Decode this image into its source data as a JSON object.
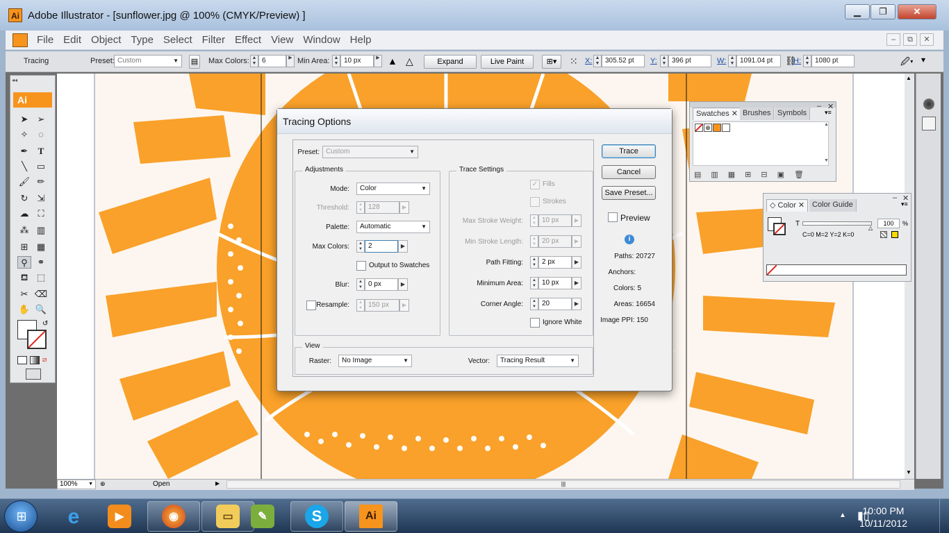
{
  "window": {
    "title": "Adobe Illustrator - [sunflower.jpg @ 100% (CMYK/Preview) ]",
    "app_icon": "Ai",
    "min_icon": "minimize-icon",
    "max_icon": "maximize-icon",
    "close_icon": "close-icon"
  },
  "menubar": {
    "items": [
      "File",
      "Edit",
      "Object",
      "Type",
      "Select",
      "Filter",
      "Effect",
      "View",
      "Window",
      "Help"
    ],
    "doc_controls": [
      "–",
      "⧉",
      "✕"
    ]
  },
  "controlbar": {
    "mode_label": "Tracing",
    "preset_label": "Preset:",
    "preset_value": "Custom",
    "max_colors_label": "Max Colors:",
    "max_colors_value": "6",
    "min_area_label": "Min Area:",
    "min_area_value": "10 px",
    "expand_label": "Expand",
    "live_paint_label": "Live Paint",
    "x_label": "X:",
    "x_value": "305.52 pt",
    "y_label": "Y:",
    "y_value": "396 pt",
    "w_label": "W:",
    "w_value": "1091.04 pt",
    "h_label": "H:",
    "h_value": "1080 pt"
  },
  "toolbox": {
    "badge": "Ai"
  },
  "statusbar": {
    "zoom": "100%",
    "status": "Open"
  },
  "dialog": {
    "title": "Tracing Options",
    "preset_label": "Preset:",
    "preset_value": "Custom",
    "adjustments": {
      "title": "Adjustments",
      "mode_label": "Mode:",
      "mode_value": "Color",
      "threshold_label": "Threshold:",
      "threshold_value": "128",
      "palette_label": "Palette:",
      "palette_value": "Automatic",
      "max_colors_label": "Max Colors:",
      "max_colors_value": "2",
      "output_swatches_label": "Output to Swatches",
      "blur_label": "Blur:",
      "blur_value": "0 px",
      "resample_label": "Resample:",
      "resample_value": "150 px"
    },
    "trace_settings": {
      "title": "Trace Settings",
      "fills_label": "Fills",
      "strokes_label": "Strokes",
      "max_stroke_label": "Max Stroke Weight:",
      "max_stroke_value": "10 px",
      "min_stroke_label": "Min Stroke Length:",
      "min_stroke_value": "20 px",
      "path_fitting_label": "Path Fitting:",
      "path_fitting_value": "2 px",
      "min_area_label": "Minimum Area:",
      "min_area_value": "10 px",
      "corner_angle_label": "Corner Angle:",
      "corner_angle_value": "20",
      "ignore_white_label": "Ignore White"
    },
    "view": {
      "title": "View",
      "raster_label": "Raster:",
      "raster_value": "No Image",
      "vector_label": "Vector:",
      "vector_value": "Tracing Result"
    },
    "buttons": {
      "trace": "Trace",
      "cancel": "Cancel",
      "save_preset": "Save Preset...",
      "preview": "Preview"
    },
    "stats": {
      "paths": "Paths: 20727",
      "anchors": "Anchors:",
      "colors": "Colors: 5",
      "areas": "Areas: 16654",
      "ppi": "Image PPI: 150"
    }
  },
  "swatches_panel": {
    "tabs": [
      "Swatches",
      "Brushes",
      "Symbols"
    ]
  },
  "color_panel": {
    "tabs": [
      "Color",
      "Color Guide"
    ],
    "t_label": "T",
    "t_value": "100",
    "t_unit": "%",
    "cmyk": "C=0 M=2 Y=2 K=0"
  },
  "taskbar": {
    "apps": [
      "windows-media-player",
      "firefox",
      "explorer",
      "paint",
      "skype",
      "illustrator"
    ],
    "time": "10:00 PM",
    "date": "10/11/2012"
  },
  "colors": {
    "accent": "#f7941d",
    "sunflower": "#f9a12a"
  }
}
